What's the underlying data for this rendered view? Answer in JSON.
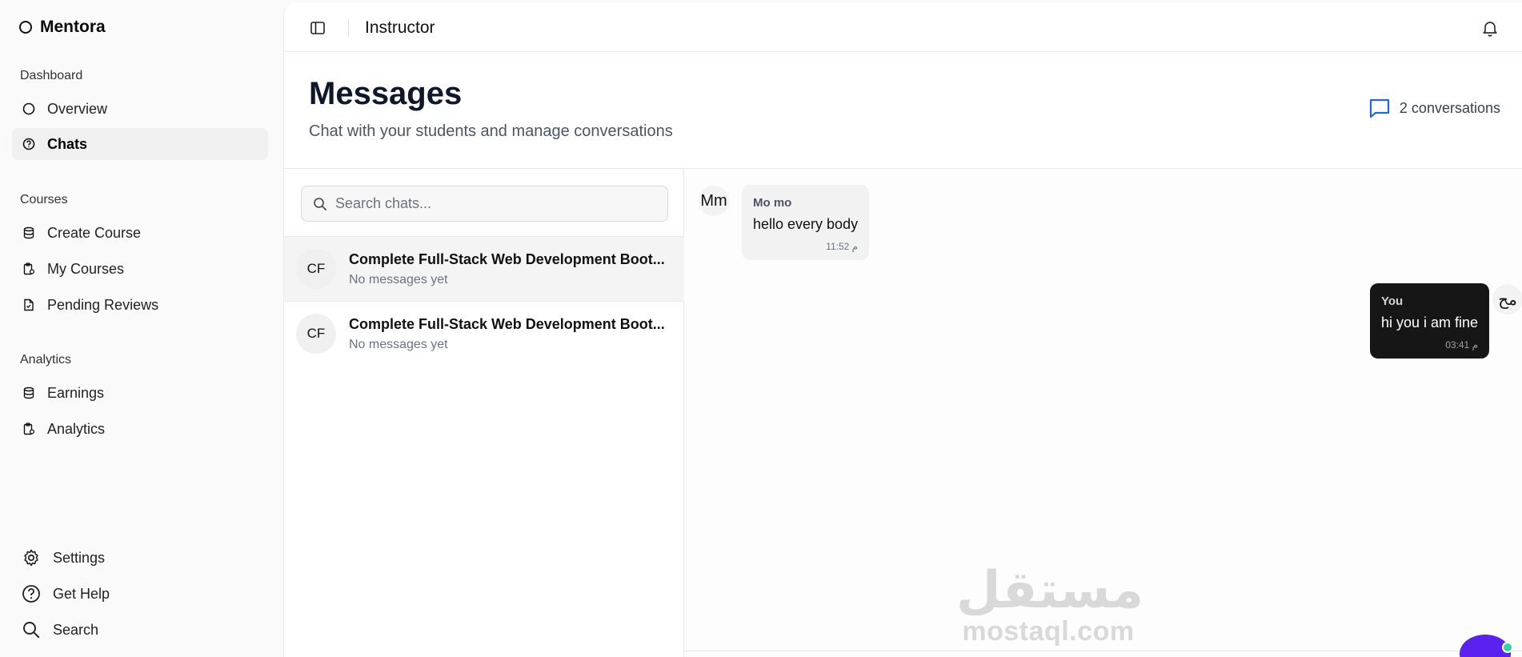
{
  "app": {
    "name": "Mentora"
  },
  "sidebar": {
    "groups": [
      {
        "label": "Dashboard",
        "items": [
          {
            "label": "Overview",
            "icon": "circle-icon",
            "active": false
          },
          {
            "label": "Chats",
            "icon": "help-circle-icon",
            "active": true
          }
        ]
      },
      {
        "label": "Courses",
        "items": [
          {
            "label": "Create Course",
            "icon": "database-icon"
          },
          {
            "label": "My Courses",
            "icon": "clipboard-icon"
          },
          {
            "label": "Pending Reviews",
            "icon": "file-icon"
          }
        ]
      },
      {
        "label": "Analytics",
        "items": [
          {
            "label": "Earnings",
            "icon": "database-icon"
          },
          {
            "label": "Analytics",
            "icon": "clipboard-icon"
          }
        ]
      }
    ],
    "footer": [
      {
        "label": "Settings",
        "icon": "gear-icon"
      },
      {
        "label": "Get Help",
        "icon": "help-circle-icon"
      },
      {
        "label": "Search",
        "icon": "search-icon"
      }
    ]
  },
  "topbar": {
    "role": "Instructor"
  },
  "header": {
    "title": "Messages",
    "subtitle": "Chat with your students and manage conversations",
    "conversation_count": "2 conversations"
  },
  "chatlist": {
    "search_placeholder": "Search chats...",
    "chats": [
      {
        "initials": "CF",
        "title": "Complete Full-Stack Web Development Boot...",
        "last_message": "No messages yet",
        "selected": true
      },
      {
        "initials": "CF",
        "title": "Complete Full-Stack Web Development Boot...",
        "last_message": "No messages yet",
        "selected": false
      }
    ]
  },
  "messages": [
    {
      "direction": "in",
      "avatar": "Mm",
      "sender": "Mo mo",
      "text": "hello every body",
      "time": "11:52 م"
    },
    {
      "direction": "out",
      "avatar": "مح",
      "sender": "You",
      "text": "hi you i am fine",
      "time": "03:41 م"
    }
  ],
  "watermark": {
    "arabic": "مستقل",
    "latin": "mostaql.com"
  },
  "colors": {
    "accent": "#2563eb",
    "fab": "#5b21f0",
    "online": "#34d399",
    "out_bubble": "#161616"
  }
}
